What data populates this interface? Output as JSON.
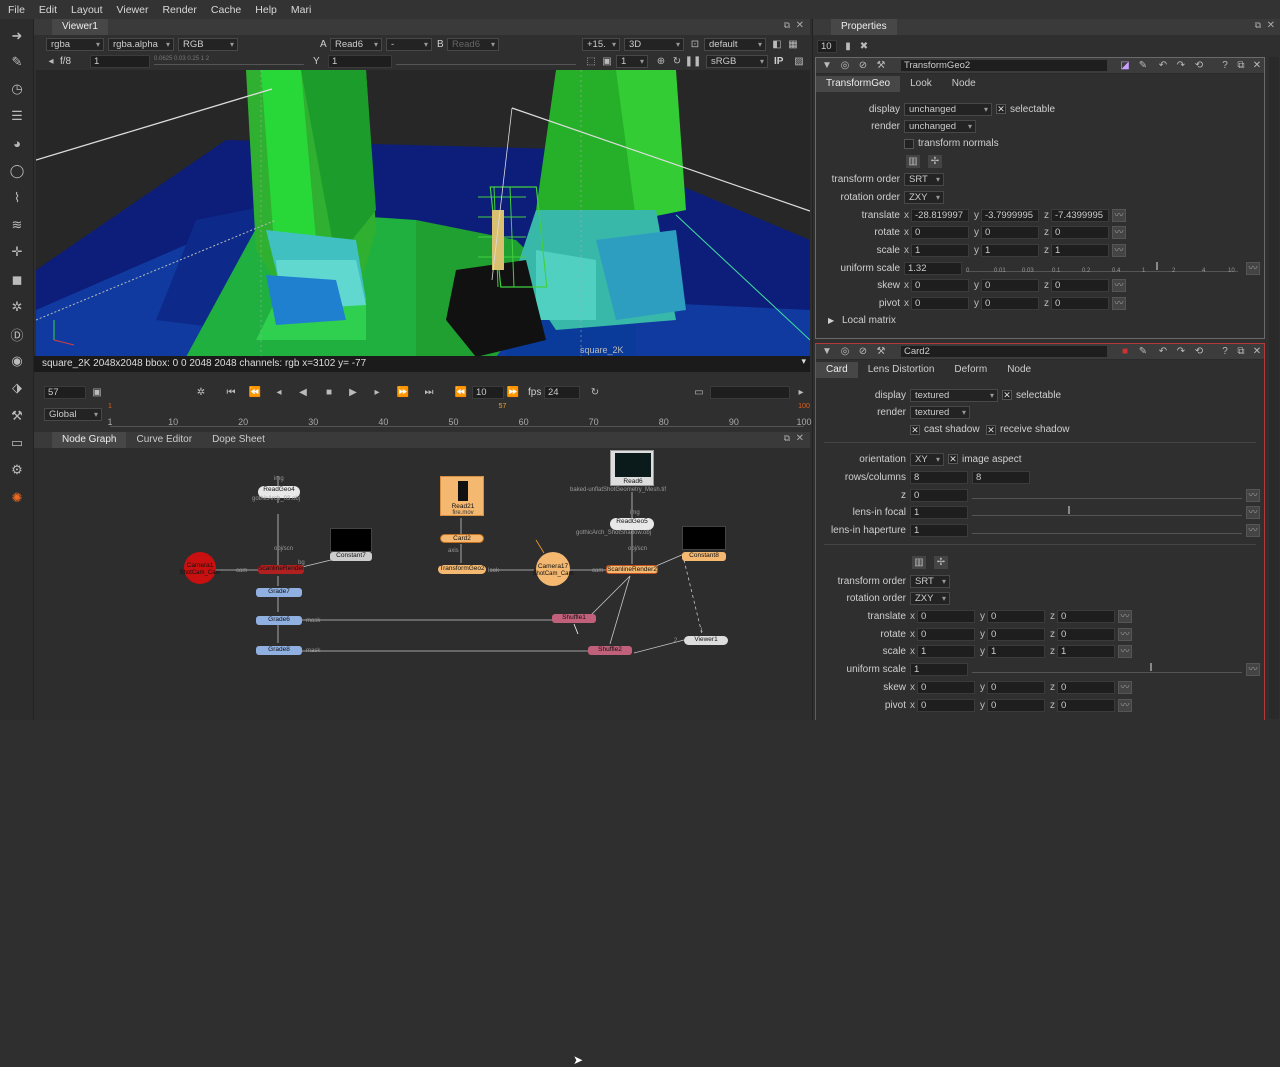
{
  "menu": [
    "File",
    "Edit",
    "Layout",
    "Viewer",
    "Render",
    "Cache",
    "Help",
    "Mari"
  ],
  "tools": [
    "pointer-icon",
    "paint-icon",
    "clock-icon",
    "layers-icon",
    "sphere-icon",
    "circle-icon",
    "brush-icon",
    "stack-icon",
    "move-icon",
    "cube-icon",
    "particles-icon",
    "deep-icon",
    "eye-icon",
    "tag-icon",
    "tools-icon",
    "box-icon",
    "toolsets-icon",
    "nuke-logo-icon"
  ],
  "viewer": {
    "tab": "Viewer1",
    "channels": "rgba",
    "alpha": "rgba.alpha",
    "mode": "RGB",
    "a_label": "A",
    "a_input": "Read6",
    "comp": "-",
    "b_label": "B",
    "b_input": "Read6",
    "zoom": "+15.",
    "view": "3D",
    "lut": "default",
    "fstop": "f/8",
    "gain": "1",
    "gain_scale": "0.0625 0.03 0.25 1 2",
    "gamma_label": "Y",
    "gamma": "1",
    "proxy": "1",
    "color": "sRGB",
    "ip": "IP",
    "status": "square_2K 2048x2048 bbox: 0 0 2048 2048 channels: rgb  x=3102 y= -77",
    "format_label": "square_2K",
    "frame": "57",
    "step": "10",
    "fps_label": "fps",
    "fps": "24",
    "range_mode": "Global",
    "ticks": [
      "1",
      "10",
      "20",
      "30",
      "40",
      "50",
      "60",
      "70",
      "80",
      "90",
      "100"
    ],
    "start_marker": "1",
    "end_marker": "100",
    "current_marker": "57"
  },
  "nodegraph": {
    "tabs": [
      "Node Graph",
      "Curve Editor",
      "Dope Sheet"
    ],
    "nodes": {
      "readgeo4": "ReadGeo4",
      "readgeo4_sub": "gothicArch_03.obj",
      "camera1": "Camera1",
      "camera1_sub": "ShotCam_Cam",
      "scanline1": "ScanlineRender1",
      "constant7": "Constant7",
      "grade7": "Grade7",
      "grade6": "Grade6",
      "grade8": "Grade8",
      "read21": "Read21",
      "read21_sub": "fire.mov",
      "card2": "Card2",
      "transformgeo": "TransformGeo2",
      "camera17": "Camera17",
      "camera17_sub": "ShotCam_Cam",
      "read6": "Read6",
      "read6_sub": "baked-unflatShotGeometry_Mesh.tif",
      "readgeo5": "ReadGeo5",
      "readgeo5_sub": "gothicArch_ShotShadow.obj",
      "constant8": "Constant8",
      "scanline2": "ScanlineRender2",
      "shuffle1": "Shuffle1",
      "shuffle2": "Shuffle2",
      "viewer1": "Viewer1"
    },
    "edge_labels": {
      "img": "img",
      "objscn": "obj/scn",
      "cam": "cam",
      "bg": "bg",
      "mask": "mask",
      "axis": "axis",
      "look": "look",
      "one": "1",
      "two": "2"
    }
  },
  "properties": {
    "tab": "Properties",
    "max_panels": "10",
    "transformgeo": {
      "name": "TransformGeo2",
      "tabs": [
        "TransformGeo",
        "Look",
        "Node"
      ],
      "display_label": "display",
      "display": "unchanged",
      "selectable": "selectable",
      "render_label": "render",
      "render": "unchanged",
      "transform_normals": "transform normals",
      "transform_order_label": "transform order",
      "transform_order": "SRT",
      "rotation_order_label": "rotation order",
      "rotation_order": "ZXY",
      "translate_label": "translate",
      "translate": [
        "-28.819997",
        "-3.7999995",
        "-7.4399995"
      ],
      "rotate_label": "rotate",
      "rotate": [
        "0",
        "0",
        "0"
      ],
      "scale_label": "scale",
      "scale": [
        "1",
        "1",
        "1"
      ],
      "uniform_scale_label": "uniform scale",
      "uniform_scale": "1.32",
      "skew_label": "skew",
      "skew": [
        "0",
        "0",
        "0"
      ],
      "pivot_label": "pivot",
      "pivot": [
        "0",
        "0",
        "0"
      ],
      "local_matrix": "Local matrix",
      "slider_ticks": [
        "0",
        "0.01",
        "0.03",
        "0.1",
        "0.2",
        "0.4",
        "1",
        "2",
        "4",
        "10"
      ]
    },
    "card": {
      "name": "Card2",
      "tabs": [
        "Card",
        "Lens Distortion",
        "Deform",
        "Node"
      ],
      "display_label": "display",
      "display": "textured",
      "selectable": "selectable",
      "render_label": "render",
      "render": "textured",
      "cast_shadow": "cast shadow",
      "receive_shadow": "receive shadow",
      "orientation_label": "orientation",
      "orientation": "XY",
      "image_aspect": "image aspect",
      "rows_label": "rows/columns",
      "rows": "8",
      "cols": "8",
      "z_label": "z",
      "z": "0",
      "focal_label": "lens-in focal",
      "focal": "1",
      "haperture_label": "lens-in haperture",
      "haperture": "1",
      "transform_order_label": "transform order",
      "transform_order": "SRT",
      "rotation_order_label": "rotation order",
      "rotation_order": "ZXY",
      "translate_label": "translate",
      "translate": [
        "0",
        "0",
        "0"
      ],
      "rotate_label": "rotate",
      "rotate": [
        "0",
        "0",
        "0"
      ],
      "scale_label": "scale",
      "scale": [
        "1",
        "1",
        "1"
      ],
      "uniform_scale_label": "uniform scale",
      "uniform_scale": "1",
      "skew_label": "skew",
      "skew": [
        "0",
        "0",
        "0"
      ],
      "pivot_label": "pivot",
      "pivot": [
        "0",
        "0",
        "0"
      ]
    }
  },
  "axis": {
    "x": "x",
    "y": "y",
    "z": "z"
  },
  "colors": {
    "accent": "#f0a030",
    "panel": "#2f2f2f",
    "viewer_bg": "#262626",
    "selected_border": "#b23a3a"
  }
}
